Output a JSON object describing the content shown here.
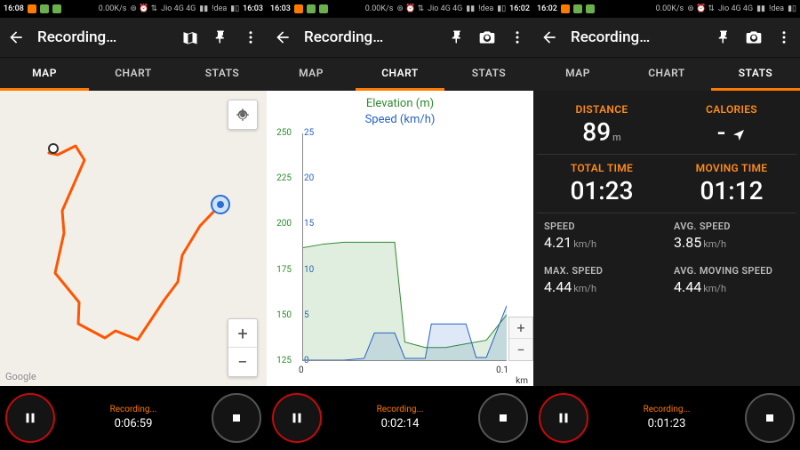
{
  "screens": [
    {
      "status": {
        "clock": "16:08",
        "net": "0.00K/s",
        "carrier": "Jio 4G 4G",
        "carrier2": "!dea",
        "time_right": "16:03"
      },
      "appbar": {
        "title": "Recording…"
      },
      "tabs": {
        "map": "MAP",
        "chart": "CHART",
        "stats": "STATS",
        "active": "map"
      },
      "map": {
        "attribution": "Google"
      },
      "rec": {
        "label": "Recording...",
        "elapsed": "0:06:59"
      }
    },
    {
      "status": {
        "clock": "16:03",
        "net": "0.00K/s",
        "carrier": "Jio 4G 4G",
        "carrier2": "!dea",
        "time_right": "16:02"
      },
      "appbar": {
        "title": "Recording…"
      },
      "tabs": {
        "map": "MAP",
        "chart": "CHART",
        "stats": "STATS",
        "active": "chart"
      },
      "rec": {
        "label": "Recording...",
        "elapsed": "0:02:14"
      }
    },
    {
      "status": {
        "clock": "16:02",
        "net": "0.00K/s",
        "carrier": "Jio 4G 4G",
        "carrier2": "!dea",
        "time_right": ""
      },
      "appbar": {
        "title": "Recording…"
      },
      "tabs": {
        "map": "MAP",
        "chart": "CHART",
        "stats": "STATS",
        "active": "stats"
      },
      "stats": {
        "distance": {
          "label": "DISTANCE",
          "value": "89",
          "unit": "m"
        },
        "calories": {
          "label": "CALORIES",
          "value": "-"
        },
        "totalTime": {
          "label": "TOTAL TIME",
          "value": "01:23"
        },
        "movingTime": {
          "label": "MOVING TIME",
          "value": "01:12"
        },
        "speed": {
          "label": "SPEED",
          "value": "4.21",
          "unit": "km/h"
        },
        "avgSpeed": {
          "label": "AVG. SPEED",
          "value": "3.85",
          "unit": "km/h"
        },
        "maxSpeed": {
          "label": "MAX. SPEED",
          "value": "4.44",
          "unit": "km/h"
        },
        "avgMovingSpeed": {
          "label": "AVG. MOVING SPEED",
          "value": "4.44",
          "unit": "km/h"
        }
      },
      "rec": {
        "label": "Recording...",
        "elapsed": "0:01:23"
      }
    }
  ],
  "chart_data": {
    "type": "line",
    "title_lines": [
      "Elevation (m)",
      "Speed (km/h)"
    ],
    "x": {
      "unit": "km",
      "min": 0.0,
      "max": 0.1,
      "ticks": [
        0.0,
        0.1
      ]
    },
    "y_left": {
      "label": "Elevation (m)",
      "min": 125,
      "max": 250,
      "ticks": [
        125,
        150,
        175,
        200,
        225,
        250
      ]
    },
    "y_right": {
      "label": "Speed (km/h)",
      "min": 0,
      "max": 25,
      "ticks": [
        0,
        5,
        10,
        15,
        20,
        25
      ]
    },
    "series": [
      {
        "name": "Elevation",
        "axis": "left",
        "color": "#2e8b2e",
        "x": [
          0.0,
          0.01,
          0.02,
          0.03,
          0.04,
          0.045,
          0.05,
          0.06,
          0.07,
          0.08,
          0.09,
          0.1
        ],
        "y": [
          187,
          189,
          190,
          190,
          190,
          190,
          135,
          132,
          132,
          134,
          136,
          150
        ]
      },
      {
        "name": "Speed",
        "axis": "right",
        "color": "#2962c4",
        "x": [
          0.0,
          0.01,
          0.02,
          0.03,
          0.035,
          0.04,
          0.045,
          0.05,
          0.06,
          0.063,
          0.07,
          0.08,
          0.085,
          0.09,
          0.1
        ],
        "y": [
          0,
          0,
          0,
          0.2,
          3,
          3,
          3,
          0.2,
          0.2,
          4,
          4,
          4,
          0.3,
          0.3,
          6
        ]
      }
    ]
  }
}
